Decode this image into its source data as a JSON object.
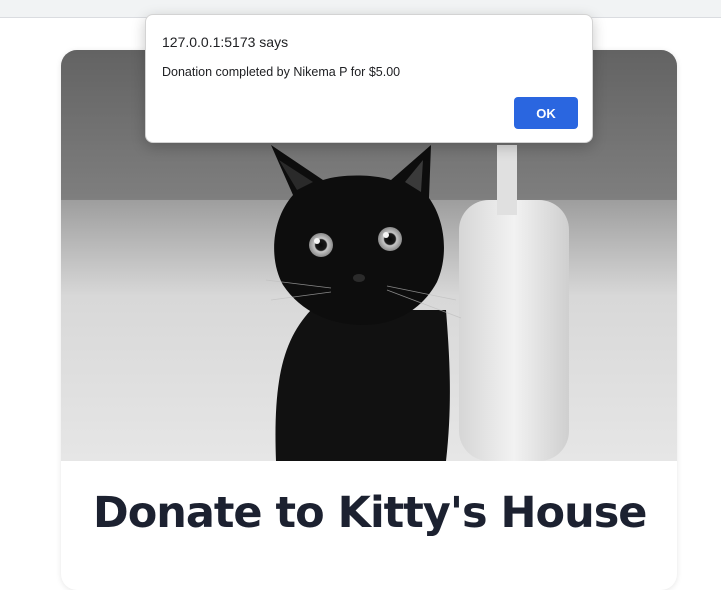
{
  "alert": {
    "origin_title": "127.0.0.1:5173 says",
    "message": "Donation completed by Nikema P for $5.00",
    "ok_label": "OK",
    "ok_color": "#2a66e0"
  },
  "card": {
    "title": "Donate to Kitty's House",
    "hero_image": "black-cat-photo"
  },
  "colors": {
    "title_text": "#1c2130",
    "page_background": "#ffffff"
  }
}
